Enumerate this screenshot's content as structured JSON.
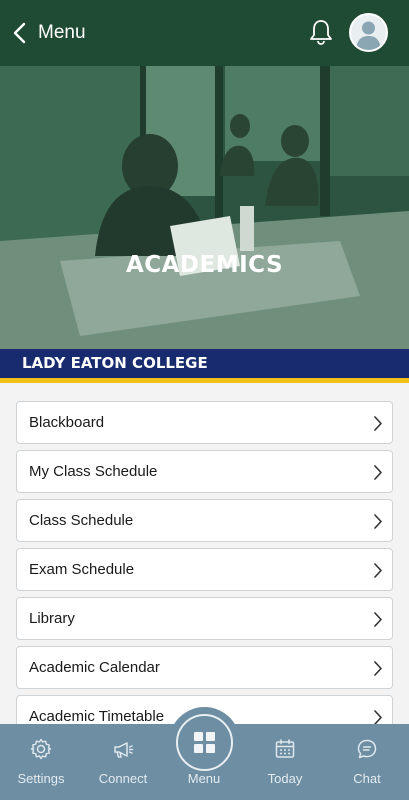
{
  "header": {
    "back_label": "Menu"
  },
  "hero": {
    "title": "ACADEMICS"
  },
  "college": {
    "name": "LADY EATON COLLEGE"
  },
  "items": [
    {
      "label": "Blackboard"
    },
    {
      "label": "My Class Schedule"
    },
    {
      "label": "Class Schedule"
    },
    {
      "label": "Exam Schedule"
    },
    {
      "label": "Library"
    },
    {
      "label": "Academic Calendar"
    },
    {
      "label": "Academic Timetable"
    }
  ],
  "tabs": [
    {
      "label": "Settings",
      "icon": "gear-icon"
    },
    {
      "label": "Connect",
      "icon": "megaphone-icon"
    },
    {
      "label": "Menu",
      "icon": "grid-icon"
    },
    {
      "label": "Today",
      "icon": "calendar-icon"
    },
    {
      "label": "Chat",
      "icon": "chat-icon"
    }
  ],
  "colors": {
    "header": "#1f4a33",
    "college_band": "#172b6e",
    "accent": "#f2c21a",
    "tabbar": "#6d8ea3"
  }
}
